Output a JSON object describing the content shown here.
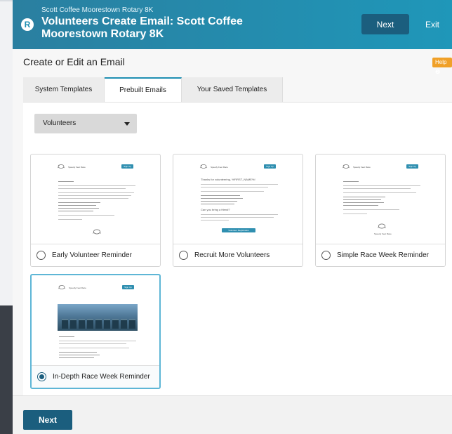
{
  "header": {
    "subtitle": "Scott Coffee Moorestown Rotary 8K",
    "title": "Volunteers Create Email: Scott Coffee Moorestown Rotary 8K",
    "logo_letter": "R",
    "next_label": "Next",
    "exit_label": "Exit"
  },
  "page": {
    "title": "Create or Edit an Email",
    "help_label": "Help ❷"
  },
  "tabs": [
    {
      "label": "System Templates",
      "active": false
    },
    {
      "label": "Prebuilt Emails",
      "active": true
    },
    {
      "label": "Your Saved Templates",
      "active": false
    }
  ],
  "dropdown": {
    "selected": "Volunteers"
  },
  "templates": [
    {
      "name": "Early Volunteer Reminder",
      "selected": false
    },
    {
      "name": "Recruit More Volunteers",
      "selected": false,
      "heading": "Thanks for volunteering, %FIRST_NAME%!",
      "subheading": "Can you bring a friend?",
      "cta": "Volunteer Registration"
    },
    {
      "name": "Simple Race Week Reminder",
      "selected": false
    },
    {
      "name": "In-Depth Race Week Reminder",
      "selected": true
    }
  ],
  "email_thumb": {
    "brand": "Speedy Feet Race",
    "button": "Sign Up"
  },
  "footer": {
    "next_label": "Next"
  },
  "colors": {
    "header_start": "#2a7fa0",
    "header_end": "#1f97b9",
    "primary_button": "#1b5e7e",
    "help_badge": "#f0a027",
    "selected_border": "#5eb6d6"
  }
}
